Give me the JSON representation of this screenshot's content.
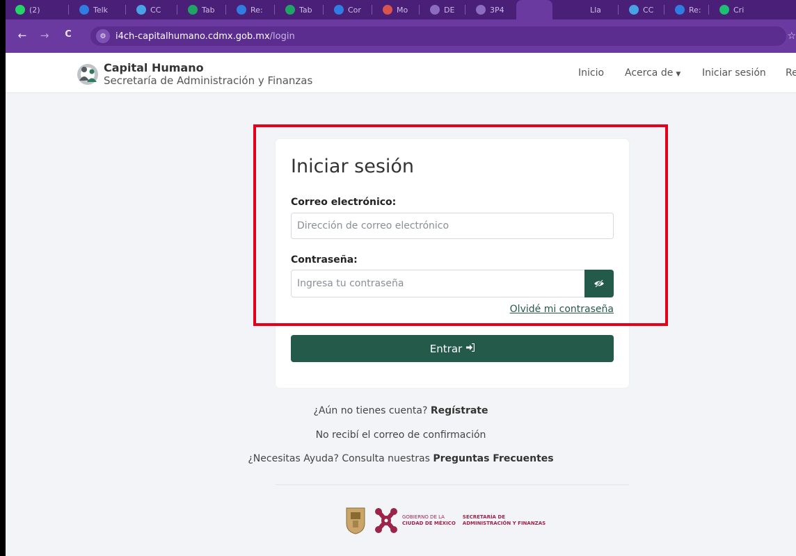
{
  "browser": {
    "url_host": "i4ch-capitalhumano.cdmx.gob.mx",
    "url_path": "/login",
    "tabs": [
      "(2)",
      "Telk",
      "CC",
      "Tab",
      "Re:",
      "Tab",
      "Cor",
      "Mo",
      "DE",
      "3P4",
      "Lla",
      "CC",
      "Re:",
      "Cri"
    ],
    "icons": {
      "back": "←",
      "forward": "→",
      "reload": "C",
      "site_info": "⚙",
      "bookmark": "☆"
    }
  },
  "header": {
    "brand_title": "Capital Humano",
    "brand_subtitle": "Secretaría de Administración y Finanzas",
    "nav": {
      "inicio": "Inicio",
      "acerca": "Acerca de",
      "iniciar": "Iniciar sesión",
      "registro": "Re"
    }
  },
  "login": {
    "title": "Iniciar sesión",
    "email_label": "Correo electrónico:",
    "email_placeholder": "Dirección de correo electrónico",
    "password_label": "Contraseña:",
    "password_placeholder": "Ingresa tu contraseña",
    "forgot": "Olvidé mi contraseña",
    "submit": "Entrar"
  },
  "footer": {
    "no_account_q": "¿Aún no tienes cuenta?",
    "register": "Regístrate",
    "no_email": "No recibí el correo de confirmación",
    "help_q": "¿Necesitas Ayuda? Consulta nuestras",
    "faq": "Preguntas Frecuentes"
  },
  "logos": {
    "gov_line1": "GOBIERNO DE LA",
    "gov_line2": "CIUDAD DE MÉXICO",
    "sec_line1": "SECRETARÍA DE",
    "sec_line2": "ADMINISTRACIÓN Y FINANZAS"
  },
  "colors": {
    "accent": "#245a4a",
    "highlight": "#e5001c",
    "chrome": "#6a3aa0",
    "brand": "#9d2449"
  }
}
